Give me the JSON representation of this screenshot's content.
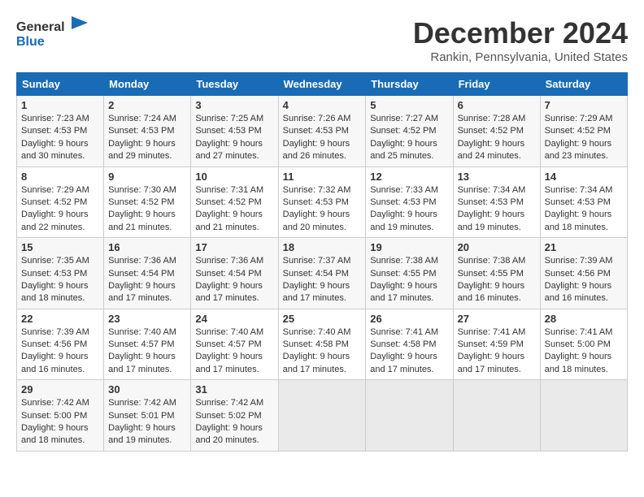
{
  "header": {
    "logo_line1": "General",
    "logo_line2": "Blue",
    "month_title": "December 2024",
    "location": "Rankin, Pennsylvania, United States"
  },
  "weekdays": [
    "Sunday",
    "Monday",
    "Tuesday",
    "Wednesday",
    "Thursday",
    "Friday",
    "Saturday"
  ],
  "weeks": [
    [
      {
        "day": "1",
        "sunrise": "7:23 AM",
        "sunset": "4:53 PM",
        "daylight": "9 hours and 30 minutes."
      },
      {
        "day": "2",
        "sunrise": "7:24 AM",
        "sunset": "4:53 PM",
        "daylight": "9 hours and 29 minutes."
      },
      {
        "day": "3",
        "sunrise": "7:25 AM",
        "sunset": "4:53 PM",
        "daylight": "9 hours and 27 minutes."
      },
      {
        "day": "4",
        "sunrise": "7:26 AM",
        "sunset": "4:53 PM",
        "daylight": "9 hours and 26 minutes."
      },
      {
        "day": "5",
        "sunrise": "7:27 AM",
        "sunset": "4:52 PM",
        "daylight": "9 hours and 25 minutes."
      },
      {
        "day": "6",
        "sunrise": "7:28 AM",
        "sunset": "4:52 PM",
        "daylight": "9 hours and 24 minutes."
      },
      {
        "day": "7",
        "sunrise": "7:29 AM",
        "sunset": "4:52 PM",
        "daylight": "9 hours and 23 minutes."
      }
    ],
    [
      {
        "day": "8",
        "sunrise": "7:29 AM",
        "sunset": "4:52 PM",
        "daylight": "9 hours and 22 minutes."
      },
      {
        "day": "9",
        "sunrise": "7:30 AM",
        "sunset": "4:52 PM",
        "daylight": "9 hours and 21 minutes."
      },
      {
        "day": "10",
        "sunrise": "7:31 AM",
        "sunset": "4:52 PM",
        "daylight": "9 hours and 21 minutes."
      },
      {
        "day": "11",
        "sunrise": "7:32 AM",
        "sunset": "4:53 PM",
        "daylight": "9 hours and 20 minutes."
      },
      {
        "day": "12",
        "sunrise": "7:33 AM",
        "sunset": "4:53 PM",
        "daylight": "9 hours and 19 minutes."
      },
      {
        "day": "13",
        "sunrise": "7:34 AM",
        "sunset": "4:53 PM",
        "daylight": "9 hours and 19 minutes."
      },
      {
        "day": "14",
        "sunrise": "7:34 AM",
        "sunset": "4:53 PM",
        "daylight": "9 hours and 18 minutes."
      }
    ],
    [
      {
        "day": "15",
        "sunrise": "7:35 AM",
        "sunset": "4:53 PM",
        "daylight": "9 hours and 18 minutes."
      },
      {
        "day": "16",
        "sunrise": "7:36 AM",
        "sunset": "4:54 PM",
        "daylight": "9 hours and 17 minutes."
      },
      {
        "day": "17",
        "sunrise": "7:36 AM",
        "sunset": "4:54 PM",
        "daylight": "9 hours and 17 minutes."
      },
      {
        "day": "18",
        "sunrise": "7:37 AM",
        "sunset": "4:54 PM",
        "daylight": "9 hours and 17 minutes."
      },
      {
        "day": "19",
        "sunrise": "7:38 AM",
        "sunset": "4:55 PM",
        "daylight": "9 hours and 17 minutes."
      },
      {
        "day": "20",
        "sunrise": "7:38 AM",
        "sunset": "4:55 PM",
        "daylight": "9 hours and 16 minutes."
      },
      {
        "day": "21",
        "sunrise": "7:39 AM",
        "sunset": "4:56 PM",
        "daylight": "9 hours and 16 minutes."
      }
    ],
    [
      {
        "day": "22",
        "sunrise": "7:39 AM",
        "sunset": "4:56 PM",
        "daylight": "9 hours and 16 minutes."
      },
      {
        "day": "23",
        "sunrise": "7:40 AM",
        "sunset": "4:57 PM",
        "daylight": "9 hours and 17 minutes."
      },
      {
        "day": "24",
        "sunrise": "7:40 AM",
        "sunset": "4:57 PM",
        "daylight": "9 hours and 17 minutes."
      },
      {
        "day": "25",
        "sunrise": "7:40 AM",
        "sunset": "4:58 PM",
        "daylight": "9 hours and 17 minutes."
      },
      {
        "day": "26",
        "sunrise": "7:41 AM",
        "sunset": "4:58 PM",
        "daylight": "9 hours and 17 minutes."
      },
      {
        "day": "27",
        "sunrise": "7:41 AM",
        "sunset": "4:59 PM",
        "daylight": "9 hours and 17 minutes."
      },
      {
        "day": "28",
        "sunrise": "7:41 AM",
        "sunset": "5:00 PM",
        "daylight": "9 hours and 18 minutes."
      }
    ],
    [
      {
        "day": "29",
        "sunrise": "7:42 AM",
        "sunset": "5:00 PM",
        "daylight": "9 hours and 18 minutes."
      },
      {
        "day": "30",
        "sunrise": "7:42 AM",
        "sunset": "5:01 PM",
        "daylight": "9 hours and 19 minutes."
      },
      {
        "day": "31",
        "sunrise": "7:42 AM",
        "sunset": "5:02 PM",
        "daylight": "9 hours and 20 minutes."
      },
      null,
      null,
      null,
      null
    ]
  ]
}
